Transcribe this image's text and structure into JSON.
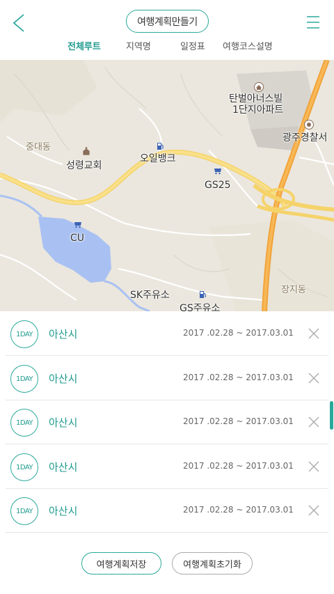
{
  "header": {
    "title": "여행계획만들기",
    "tabs": [
      {
        "label": "전체루트",
        "active": true
      },
      {
        "label": "지역명",
        "active": false
      },
      {
        "label": "일정표",
        "active": false
      },
      {
        "label": "여행코스설명",
        "active": false
      }
    ]
  },
  "map": {
    "labels": {
      "apartment": "탄벌아너스빌",
      "apartment2": "1단지아파트",
      "police": "광주경찰서",
      "area1": "중대동",
      "church": "성령교회",
      "oilbank": "오일뱅크",
      "gs25": "GS25",
      "cu": "CU",
      "area2": "장지동",
      "sk": "SK주유소",
      "gs": "GS주유소"
    }
  },
  "plans": [
    {
      "day": "1DAY",
      "city": "아산시",
      "dates": "2017 .02.28 ~ 2017.03.01"
    },
    {
      "day": "1DAY",
      "city": "아산시",
      "dates": "2017 .02.28 ~ 2017.03.01"
    },
    {
      "day": "1DAY",
      "city": "아산시",
      "dates": "2017 .02.28 ~ 2017.03.01"
    },
    {
      "day": "1DAY",
      "city": "아산시",
      "dates": "2017 .02.28 ~ 2017.03.01"
    },
    {
      "day": "1DAY",
      "city": "아산시",
      "dates": "2017 .02.28 ~ 2017.03.01"
    }
  ],
  "footer": {
    "save_label": "여행계획저장",
    "reset_label": "여행계획초기화"
  },
  "colors": {
    "accent": "#2aa99b"
  }
}
